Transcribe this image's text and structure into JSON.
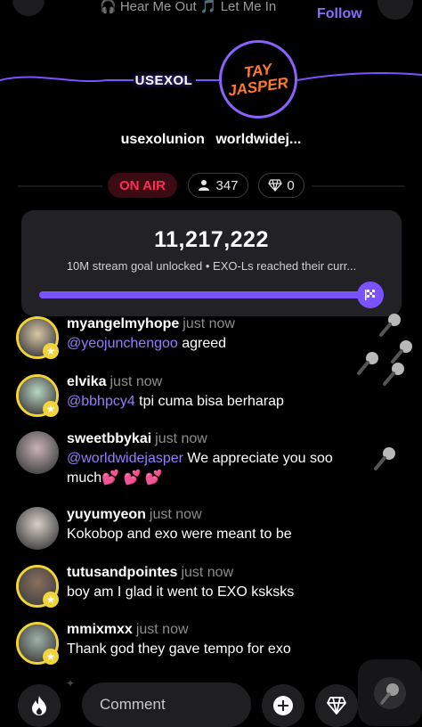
{
  "top": {
    "now_playing": "🎧 Hear Me Out 🎵 Let Me In",
    "follow_label": "Follow"
  },
  "header": {
    "host_logo_text": "USEXOL",
    "guest_logo_text_1": "TAY",
    "guest_logo_text_2": "JASPER",
    "host_name": "usexolunion",
    "guest_name": "worldwidej...",
    "status_label": "ON AIR",
    "viewer_count": "347",
    "gem_count": "0"
  },
  "goal": {
    "count": "11,217,222",
    "message": "10M stream goal unlocked • EXO-Ls reached their curr...",
    "progress_fraction": 1.0
  },
  "comments": [
    {
      "user": "myangelmyhope",
      "time": "just now",
      "mention": "@yeojunchengoo",
      "text": " agreed",
      "ring": true,
      "avatar_color": "#d9c7a6"
    },
    {
      "user": "elvika",
      "time": "just now",
      "mention": "@bbhpcy4",
      "text": " tpi cuma bisa berharap",
      "ring": true,
      "avatar_color": "#b9d6c1"
    },
    {
      "user": "sweetbbykai",
      "time": "just now",
      "mention": "@worldwidejasper",
      "text": " We appreciate you soo much💕 💕 💕",
      "ring": false,
      "avatar_color": "#c9b3b8"
    },
    {
      "user": "yuyumyeon",
      "time": "just now",
      "mention": "",
      "text": "Kokobop and exo were meant to be",
      "ring": false,
      "avatar_color": "#d8d0c8"
    },
    {
      "user": "tutusandpointes",
      "time": "just now",
      "mention": "",
      "text": "boy am I glad it went to EXO ksksks",
      "ring": true,
      "avatar_color": "#8a6f5c"
    },
    {
      "user": "mmixmxx",
      "time": "just now",
      "mention": "",
      "text": "Thank god they gave tempo for exo",
      "ring": true,
      "avatar_color": "#9fb2a8"
    }
  ],
  "bottom": {
    "comment_placeholder": "Comment"
  },
  "colors": {
    "accent": "#7a52ff",
    "on_air": "#ff2c55",
    "vip_ring": "#f1d33a",
    "mention": "#9a7cff"
  },
  "icons": [
    "headphones-icon",
    "music-note-icon",
    "person-icon",
    "diamond-icon",
    "flag-icon",
    "microphone-icon",
    "flame-icon",
    "plus-icon"
  ]
}
